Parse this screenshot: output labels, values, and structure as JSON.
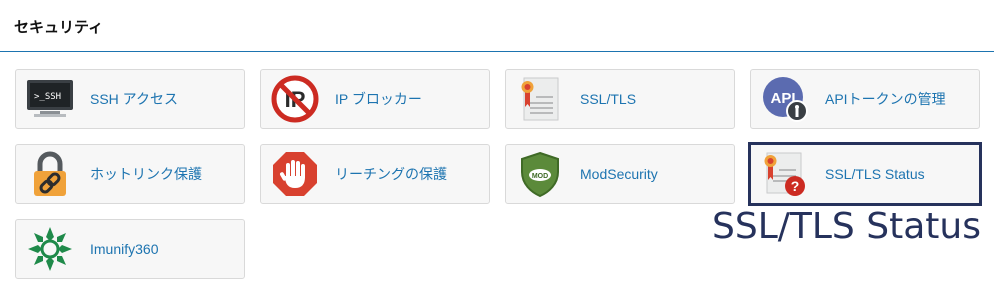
{
  "section": {
    "title": "セキュリティ"
  },
  "tiles": [
    {
      "label": "SSH アクセス",
      "icon": "terminal-icon",
      "terminal_text": ">_SSH"
    },
    {
      "label": "IP ブロッカー",
      "icon": "ip-blocker-icon",
      "icon_text": "IP"
    },
    {
      "label": "SSL/TLS",
      "icon": "certificate-icon"
    },
    {
      "label": "APIトークンの管理",
      "icon": "api-token-icon",
      "icon_text": "API"
    },
    {
      "label": "ホットリンク保護",
      "icon": "padlock-link-icon"
    },
    {
      "label": "リーチングの保護",
      "icon": "stop-hand-icon"
    },
    {
      "label": "ModSecurity",
      "icon": "shield-mod-icon",
      "icon_text": "MOD"
    },
    {
      "label": "SSL/TLS Status",
      "icon": "certificate-question-icon",
      "icon_text": "?"
    },
    {
      "label": "Imunify360",
      "icon": "imunify-icon"
    }
  ],
  "callout": {
    "text": "SSL/TLS Status"
  },
  "colors": {
    "accent": "#1d74b0",
    "highlight": "#26325c",
    "tile_bg": "#f7f7f7",
    "tile_border": "#d9d9d9"
  }
}
